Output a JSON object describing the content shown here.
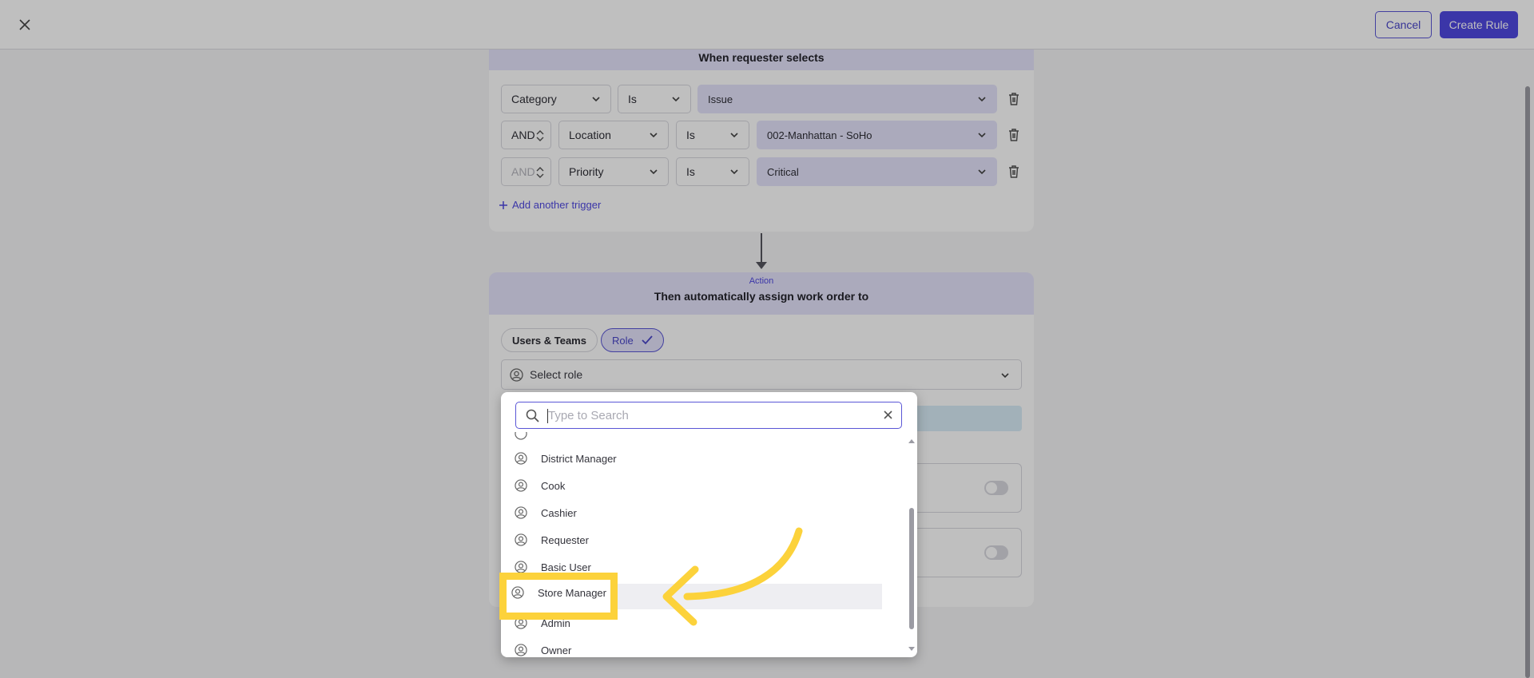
{
  "header": {
    "cancel_label": "Cancel",
    "create_label": "Create Rule"
  },
  "trigger": {
    "title": "When requester selects",
    "rows": [
      {
        "connector": "",
        "field": "Category",
        "operator": "Is",
        "value": "Issue"
      },
      {
        "connector": "AND",
        "field": "Location",
        "operator": "Is",
        "value": "002-Manhattan - SoHo"
      },
      {
        "connector": "AND",
        "field": "Priority",
        "operator": "Is",
        "value": "Critical"
      }
    ],
    "add_label": "Add another trigger"
  },
  "action": {
    "label": "Action",
    "title": "Then automatically assign work order to",
    "tabs": [
      "Users & Teams",
      "Role"
    ],
    "role_placeholder": "Select role"
  },
  "dropdown": {
    "search_placeholder": "Type to Search",
    "items": [
      "District Manager",
      "Cook",
      "Cashier",
      "Requester",
      "Basic User",
      "Store Manager",
      "Admin",
      "Owner"
    ],
    "highlighted": "Store Manager"
  },
  "colors": {
    "accent": "#4f48e0",
    "header_tint": "#e4e3fb",
    "callout": "#fcd23b"
  }
}
